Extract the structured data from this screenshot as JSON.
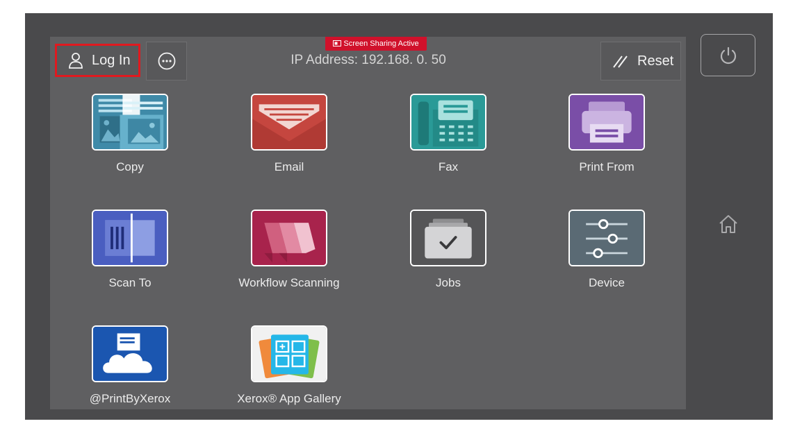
{
  "header": {
    "screen_sharing_label": "Screen Sharing Active",
    "login_label": "Log In",
    "ip_address": "IP Address: 192.168. 0. 50",
    "reset_label": "Reset"
  },
  "apps": [
    {
      "id": "copy",
      "label": "Copy",
      "icon": "copy-icon",
      "color": "#3f8aa8"
    },
    {
      "id": "email",
      "label": "Email",
      "icon": "email-icon",
      "color": "#c5463f"
    },
    {
      "id": "fax",
      "label": "Fax",
      "icon": "fax-icon",
      "color": "#2a9a97"
    },
    {
      "id": "print-from",
      "label": "Print From",
      "icon": "print-icon",
      "color": "#7a4ea7"
    },
    {
      "id": "scan-to",
      "label": "Scan To",
      "icon": "scan-icon",
      "color": "#4a5ec0"
    },
    {
      "id": "workflow-scanning",
      "label": "Workflow Scanning",
      "icon": "workflow-icon",
      "color": "#a8234c"
    },
    {
      "id": "jobs",
      "label": "Jobs",
      "icon": "jobs-icon",
      "color": "#555557"
    },
    {
      "id": "device",
      "label": "Device",
      "icon": "device-icon",
      "color": "#5a6a74"
    },
    {
      "id": "printbyxerox",
      "label": "@PrintByXerox",
      "icon": "cloud-print-icon",
      "color": "#1b56b0"
    },
    {
      "id": "app-gallery",
      "label": "Xerox® App Gallery",
      "icon": "app-gallery-icon",
      "color": "#f1f1f1"
    }
  ]
}
